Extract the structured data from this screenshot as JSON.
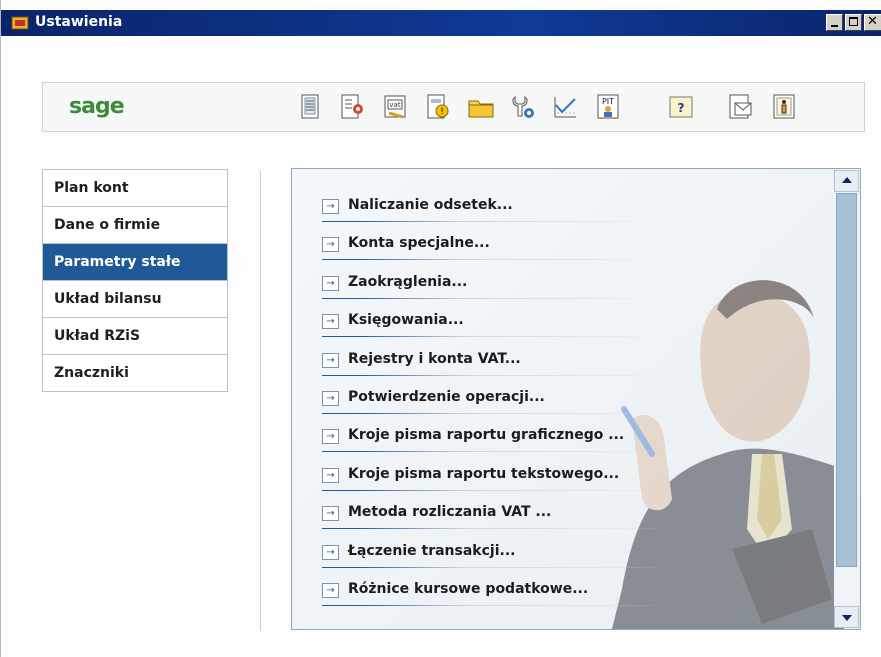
{
  "window": {
    "title": "Ustawienia"
  },
  "toolbar": {
    "logo": "sage",
    "icons": [
      "document-icon",
      "document-settings-icon",
      "vat-icon",
      "warning-document-icon",
      "folder-icon",
      "tools-icon",
      "chart-icon",
      "pit-icon",
      "help-icon",
      "mail-icon",
      "info-icon"
    ],
    "pit_label": "PIT",
    "vat_label": "vat",
    "help_label": "?"
  },
  "nav": {
    "items": [
      {
        "label": "Plan kont",
        "active": false
      },
      {
        "label": "Dane o firmie",
        "active": false
      },
      {
        "label": "Parametry stałe",
        "active": true
      },
      {
        "label": "Układ bilansu",
        "active": false
      },
      {
        "label": "Układ RZiS",
        "active": false
      },
      {
        "label": "Znaczniki",
        "active": false
      }
    ]
  },
  "panel": {
    "links": [
      "Naliczanie odsetek...",
      "Konta specjalne...",
      "Zaokrąglenia...",
      "Księgowania...",
      "Rejestry i konta VAT...",
      "Potwierdzenie operacji...",
      "Kroje pisma raportu graficznego ...",
      "Kroje pisma raportu tekstowego...",
      "Metoda rozliczania VAT ...",
      "Łączenie transakcji...",
      "Różnice kursowe podatkowe..."
    ],
    "arrow_glyph": "→"
  },
  "colors": {
    "titlebar": "#0a246a",
    "nav_active": "#1f5a96",
    "logo": "#3f8a3a",
    "scroll_thumb": "#a7bfd3"
  }
}
